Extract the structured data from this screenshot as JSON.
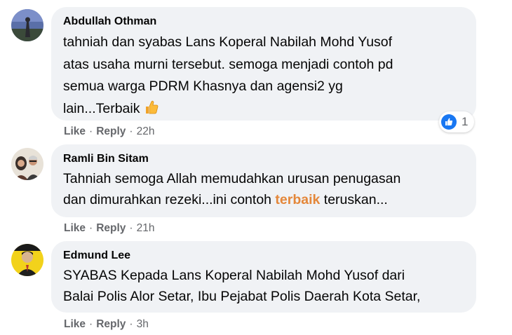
{
  "comments": [
    {
      "author": "Abdullah Othman",
      "lines": [
        "tahniah dan syabas Lans Koperal Nabilah Mohd Yusof",
        "atas usaha murni tersebut. semoga menjadi contoh pd",
        "semua warga PDRM Khasnya dan agensi2 yg",
        "lain...Terbaik"
      ],
      "emoji": "thumbs-up-emoji",
      "reaction_count": "1",
      "reaction_icon": "like-icon",
      "actions": {
        "like": "Like",
        "reply": "Reply",
        "time": "22h"
      }
    },
    {
      "author": "Ramli Bin Sitam",
      "line1": "Tahniah semoga Allah memudahkan urusan penugasan",
      "line2_before": "dan dimurahkan rezeki...ini contoh ",
      "line2_highlight": "terbaik",
      "line2_after": " teruskan...",
      "actions": {
        "like": "Like",
        "reply": "Reply",
        "time": "21h"
      }
    },
    {
      "author": "Edmund Lee",
      "lines": [
        "SYABAS Kepada Lans Koperal Nabilah Mohd Yusof dari",
        "Balai Polis Alor Setar, Ibu Pejabat Polis Daerah Kota Setar,"
      ],
      "actions": {
        "like": "Like",
        "reply": "Reply",
        "time": "3h"
      }
    }
  ],
  "separator": "·",
  "colors": {
    "bubble": "#f0f2f5",
    "meta": "#65676b",
    "highlight": "#e4873a",
    "like_blue": "#1877f2"
  }
}
